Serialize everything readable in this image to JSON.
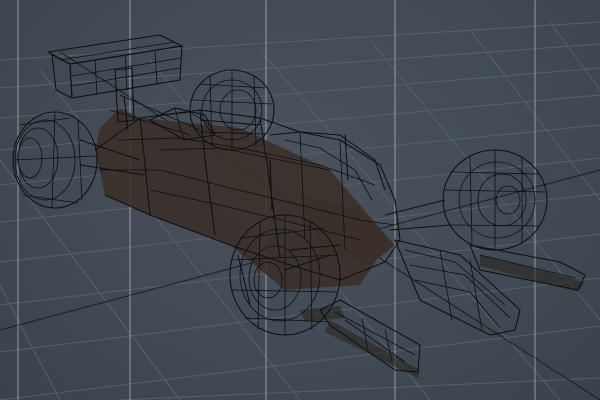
{
  "viewport": {
    "background_color": "#424b55",
    "grid_color": "#56606b",
    "wire_color": "#0d0f12",
    "body_shade_color": "#3a2f29",
    "guide_line_color": "#d7dbe0"
  },
  "model": {
    "subject": "formula-car-wireframe"
  }
}
